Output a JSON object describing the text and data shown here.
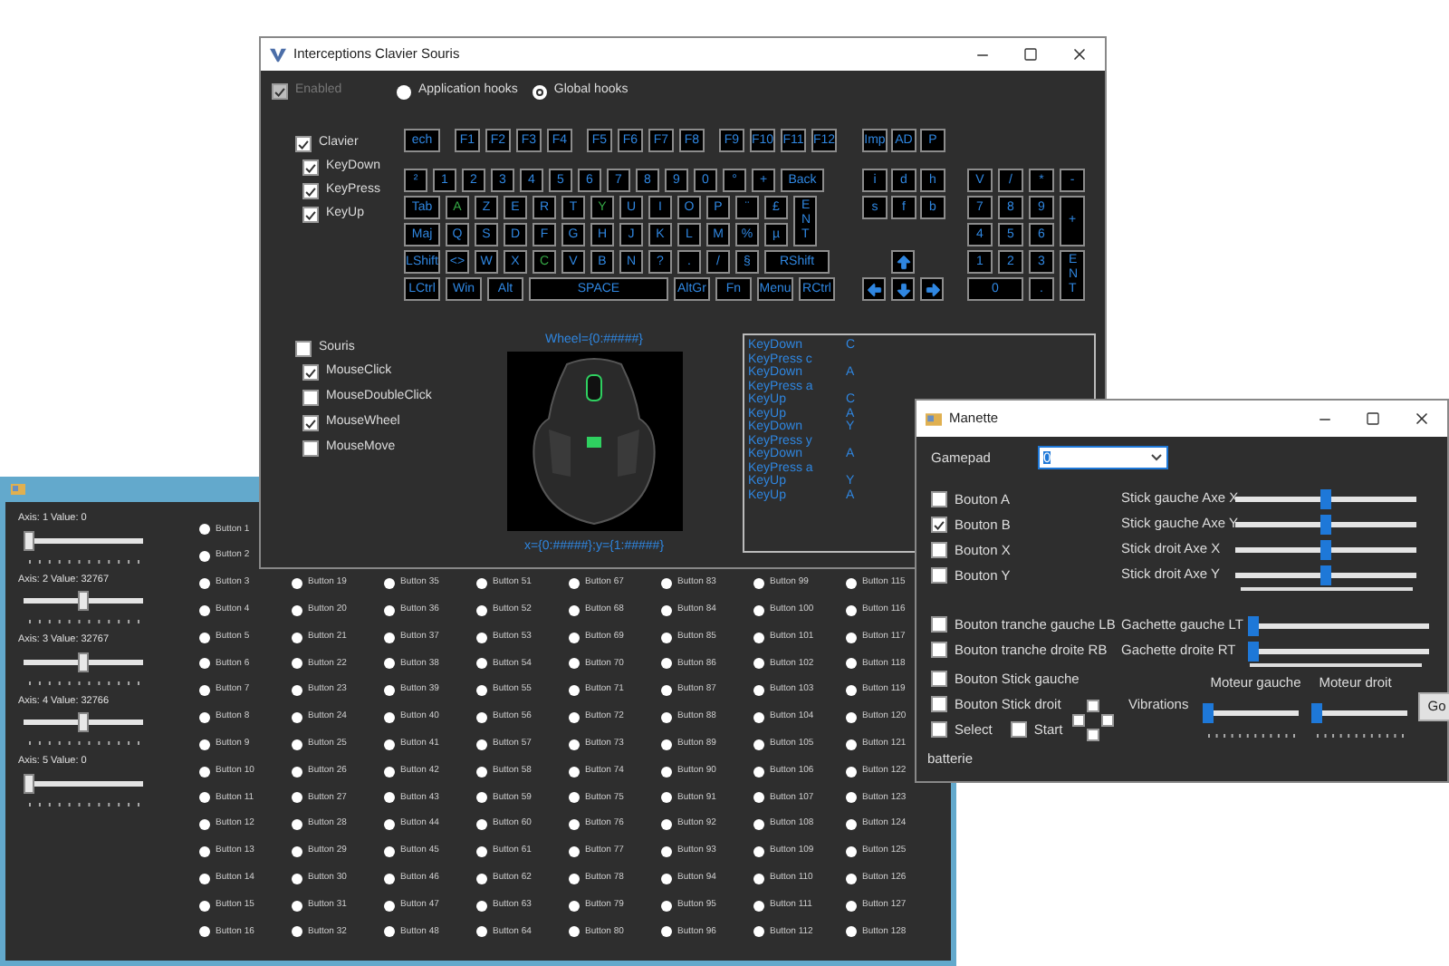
{
  "joystick_window": {
    "axes": [
      {
        "label": "Axis: 1  Value: 0",
        "level": 0
      },
      {
        "label": "Axis: 2  Value: 32767",
        "level": 0.5
      },
      {
        "label": "Axis: 3  Value: 32767",
        "level": 0.5
      },
      {
        "label": "Axis: 4  Value: 32766",
        "level": 0.5
      },
      {
        "label": "Axis: 5  Value: 0",
        "level": 0
      }
    ],
    "button_columns": [
      {
        "buttons": [
          {
            "label": "Button 1",
            "selected": false
          },
          {
            "label": "Button 2",
            "selected": false
          },
          {
            "label": "Button 3",
            "selected": false
          },
          {
            "label": "Button 4",
            "selected": false
          },
          {
            "label": "Button 5",
            "selected": false
          },
          {
            "label": "Button 6",
            "selected": false
          },
          {
            "label": "Button 7",
            "selected": false
          },
          {
            "label": "Button 8",
            "selected": false
          },
          {
            "label": "Button 9",
            "selected": false
          },
          {
            "label": "Button 10",
            "selected": false
          },
          {
            "label": "Button 11",
            "selected": false
          },
          {
            "label": "Button 12",
            "selected": false
          },
          {
            "label": "Button 13",
            "selected": false
          },
          {
            "label": "Button 14",
            "selected": false
          },
          {
            "label": "Button 15",
            "selected": false
          },
          {
            "label": "Button 16",
            "selected": false
          }
        ]
      },
      {
        "buttons": [
          {
            "label": "Button 19",
            "selected": false
          },
          {
            "label": "Button 20",
            "selected": false
          },
          {
            "label": "Button 21",
            "selected": false
          },
          {
            "label": "Button 22",
            "selected": false
          },
          {
            "label": "Button 23",
            "selected": false
          },
          {
            "label": "Button 24",
            "selected": false
          },
          {
            "label": "Button 25",
            "selected": false
          },
          {
            "label": "Button 26",
            "selected": false
          },
          {
            "label": "Button 27",
            "selected": false
          },
          {
            "label": "Button 28",
            "selected": false
          },
          {
            "label": "Button 29",
            "selected": false
          },
          {
            "label": "Button 30",
            "selected": false
          },
          {
            "label": "Button 31",
            "selected": false
          },
          {
            "label": "Button 32",
            "selected": false
          }
        ]
      },
      {
        "buttons": [
          {
            "label": "Button 35",
            "selected": false
          },
          {
            "label": "Button 36",
            "selected": false
          },
          {
            "label": "Button 37",
            "selected": false
          },
          {
            "label": "Button 38",
            "selected": false
          },
          {
            "label": "Button 39",
            "selected": false
          },
          {
            "label": "Button 40",
            "selected": false
          },
          {
            "label": "Button 41",
            "selected": false
          },
          {
            "label": "Button 42",
            "selected": false
          },
          {
            "label": "Button 43",
            "selected": false
          },
          {
            "label": "Button 44",
            "selected": false
          },
          {
            "label": "Button 45",
            "selected": false
          },
          {
            "label": "Button 46",
            "selected": false
          },
          {
            "label": "Button 47",
            "selected": false
          },
          {
            "label": "Button 48",
            "selected": false
          }
        ]
      },
      {
        "buttons": [
          {
            "label": "Button 51",
            "selected": false
          },
          {
            "label": "Button 52",
            "selected": false
          },
          {
            "label": "Button 53",
            "selected": false
          },
          {
            "label": "Button 54",
            "selected": false
          },
          {
            "label": "Button 55",
            "selected": false
          },
          {
            "label": "Button 56",
            "selected": false
          },
          {
            "label": "Button 57",
            "selected": false
          },
          {
            "label": "Button 58",
            "selected": false
          },
          {
            "label": "Button 59",
            "selected": false
          },
          {
            "label": "Button 60",
            "selected": false
          },
          {
            "label": "Button 61",
            "selected": false
          },
          {
            "label": "Button 62",
            "selected": false
          },
          {
            "label": "Button 63",
            "selected": false
          },
          {
            "label": "Button 64",
            "selected": false
          }
        ]
      },
      {
        "buttons": [
          {
            "label": "Button 67",
            "selected": false
          },
          {
            "label": "Button 68",
            "selected": false
          },
          {
            "label": "Button 69",
            "selected": false
          },
          {
            "label": "Button 70",
            "selected": false
          },
          {
            "label": "Button 71",
            "selected": false
          },
          {
            "label": "Button 72",
            "selected": false
          },
          {
            "label": "Button 73",
            "selected": false
          },
          {
            "label": "Button 74",
            "selected": false
          },
          {
            "label": "Button 75",
            "selected": false
          },
          {
            "label": "Button 76",
            "selected": false
          },
          {
            "label": "Button 77",
            "selected": false
          },
          {
            "label": "Button 78",
            "selected": false
          },
          {
            "label": "Button 79",
            "selected": false
          },
          {
            "label": "Button 80",
            "selected": false
          }
        ]
      },
      {
        "buttons": [
          {
            "label": "Button 83",
            "selected": false
          },
          {
            "label": "Button 84",
            "selected": false
          },
          {
            "label": "Button 85",
            "selected": false
          },
          {
            "label": "Button 86",
            "selected": false
          },
          {
            "label": "Button 87",
            "selected": false
          },
          {
            "label": "Button 88",
            "selected": false
          },
          {
            "label": "Button 89",
            "selected": false
          },
          {
            "label": "Button 90",
            "selected": false
          },
          {
            "label": "Button 91",
            "selected": false
          },
          {
            "label": "Button 92",
            "selected": false
          },
          {
            "label": "Button 93",
            "selected": false
          },
          {
            "label": "Button 94",
            "selected": false
          },
          {
            "label": "Button 95",
            "selected": false
          },
          {
            "label": "Button 96",
            "selected": false
          }
        ]
      },
      {
        "buttons": [
          {
            "label": "Button 99",
            "selected": false
          },
          {
            "label": "Button 100",
            "selected": false
          },
          {
            "label": "Button 101",
            "selected": false
          },
          {
            "label": "Button 102",
            "selected": false
          },
          {
            "label": "Button 103",
            "selected": false
          },
          {
            "label": "Button 104",
            "selected": false
          },
          {
            "label": "Button 105",
            "selected": false
          },
          {
            "label": "Button 106",
            "selected": false
          },
          {
            "label": "Button 107",
            "selected": false
          },
          {
            "label": "Button 108",
            "selected": false
          },
          {
            "label": "Button 109",
            "selected": false
          },
          {
            "label": "Button 110",
            "selected": false
          },
          {
            "label": "Button 111",
            "selected": false
          },
          {
            "label": "Button 112",
            "selected": false
          }
        ]
      },
      {
        "buttons": [
          {
            "label": "Button 115",
            "selected": false
          },
          {
            "label": "Button 116",
            "selected": false
          },
          {
            "label": "Button 117",
            "selected": false
          },
          {
            "label": "Button 118",
            "selected": false
          },
          {
            "label": "Button 119",
            "selected": false
          },
          {
            "label": "Button 120",
            "selected": false
          },
          {
            "label": "Button 121",
            "selected": false
          },
          {
            "label": "Button 122",
            "selected": false
          },
          {
            "label": "Button 123",
            "selected": false
          },
          {
            "label": "Button 124",
            "selected": false
          },
          {
            "label": "Button 125",
            "selected": false
          },
          {
            "label": "Button 126",
            "selected": false
          },
          {
            "label": "Button 127",
            "selected": false
          },
          {
            "label": "Button 128",
            "selected": false
          }
        ]
      }
    ]
  },
  "keyboard_window": {
    "title": "Interceptions Clavier Souris",
    "enabled": {
      "label": "Enabled",
      "checked": true,
      "disabled": true
    },
    "hooks": [
      {
        "label": "Application hooks",
        "selected": false
      },
      {
        "label": "Global hooks",
        "selected": true
      }
    ],
    "keyboard_group": {
      "label": "Clavier",
      "checked": true,
      "children": [
        {
          "label": "KeyDown",
          "checked": true
        },
        {
          "label": "KeyPress",
          "checked": true
        },
        {
          "label": "KeyUp",
          "checked": true
        }
      ]
    },
    "function_keys": [
      {
        "keys": [
          {
            "label": "ech",
            "kind": "wide",
            "pressed": false
          }
        ]
      },
      {
        "keys": [
          {
            "label": "F1",
            "kind": "normal",
            "pressed": false
          },
          {
            "label": "F2",
            "kind": "normal",
            "pressed": false
          },
          {
            "label": "F3",
            "kind": "normal",
            "pressed": false
          },
          {
            "label": "F4",
            "kind": "normal",
            "pressed": false
          }
        ]
      },
      {
        "keys": [
          {
            "label": "F5",
            "kind": "normal",
            "pressed": false
          },
          {
            "label": "F6",
            "kind": "normal",
            "pressed": false
          },
          {
            "label": "F7",
            "kind": "normal",
            "pressed": false
          },
          {
            "label": "F8",
            "kind": "normal",
            "pressed": false
          }
        ]
      },
      {
        "keys": [
          {
            "label": "F9",
            "kind": "normal",
            "pressed": false
          },
          {
            "label": "F10",
            "kind": "normal",
            "pressed": false
          },
          {
            "label": "F11",
            "kind": "normal",
            "pressed": false
          },
          {
            "label": "F12",
            "kind": "normal",
            "pressed": false
          }
        ]
      }
    ],
    "main_rows": [
      {
        "keys": [
          {
            "label": "²",
            "kind": "normal",
            "pressed": false
          },
          {
            "label": "1",
            "kind": "normal",
            "pressed": false
          },
          {
            "label": "2",
            "kind": "normal",
            "pressed": false
          },
          {
            "label": "3",
            "kind": "normal",
            "pressed": false
          },
          {
            "label": "4",
            "kind": "normal",
            "pressed": false
          },
          {
            "label": "5",
            "kind": "normal",
            "pressed": false
          },
          {
            "label": "6",
            "kind": "normal",
            "pressed": false
          },
          {
            "label": "7",
            "kind": "normal",
            "pressed": false
          },
          {
            "label": "8",
            "kind": "normal",
            "pressed": false
          },
          {
            "label": "9",
            "kind": "normal",
            "pressed": false
          },
          {
            "label": "0",
            "kind": "normal",
            "pressed": false
          },
          {
            "label": "°",
            "kind": "normal",
            "pressed": false
          },
          {
            "label": "+",
            "kind": "normal",
            "pressed": false
          },
          {
            "label": "Back",
            "kind": "back",
            "pressed": false
          }
        ]
      },
      {
        "keys": [
          {
            "label": "Tab",
            "kind": "wide",
            "pressed": false
          },
          {
            "label": "A",
            "kind": "normal",
            "pressed": true
          },
          {
            "label": "Z",
            "kind": "normal",
            "pressed": false
          },
          {
            "label": "E",
            "kind": "normal",
            "pressed": false
          },
          {
            "label": "R",
            "kind": "normal",
            "pressed": false
          },
          {
            "label": "T",
            "kind": "normal",
            "pressed": false
          },
          {
            "label": "Y",
            "kind": "normal",
            "pressed": true
          },
          {
            "label": "U",
            "kind": "normal",
            "pressed": false
          },
          {
            "label": "I",
            "kind": "normal",
            "pressed": false
          },
          {
            "label": "O",
            "kind": "normal",
            "pressed": false
          },
          {
            "label": "P",
            "kind": "normal",
            "pressed": false
          },
          {
            "label": "¨",
            "kind": "normal",
            "pressed": false
          },
          {
            "label": "£",
            "kind": "normal",
            "pressed": false
          }
        ]
      },
      {
        "keys": [
          {
            "label": "Maj",
            "kind": "wide",
            "pressed": false
          },
          {
            "label": "Q",
            "kind": "normal",
            "pressed": false
          },
          {
            "label": "S",
            "kind": "normal",
            "pressed": false
          },
          {
            "label": "D",
            "kind": "normal",
            "pressed": false
          },
          {
            "label": "F",
            "kind": "normal",
            "pressed": false
          },
          {
            "label": "G",
            "kind": "normal",
            "pressed": false
          },
          {
            "label": "H",
            "kind": "normal",
            "pressed": false
          },
          {
            "label": "J",
            "kind": "normal",
            "pressed": false
          },
          {
            "label": "K",
            "kind": "normal",
            "pressed": false
          },
          {
            "label": "L",
            "kind": "normal",
            "pressed": false
          },
          {
            "label": "M",
            "kind": "normal",
            "pressed": false
          },
          {
            "label": "%",
            "kind": "normal",
            "pressed": false
          },
          {
            "label": "µ",
            "kind": "normal",
            "pressed": false
          }
        ]
      },
      {
        "keys": [
          {
            "label": "LShift",
            "kind": "wide",
            "pressed": false
          },
          {
            "label": "<>",
            "kind": "normal",
            "pressed": false
          },
          {
            "label": "W",
            "kind": "normal",
            "pressed": false
          },
          {
            "label": "X",
            "kind": "normal",
            "pressed": false
          },
          {
            "label": "C",
            "kind": "normal",
            "pressed": true
          },
          {
            "label": "V",
            "kind": "normal",
            "pressed": false
          },
          {
            "label": "B",
            "kind": "normal",
            "pressed": false
          },
          {
            "label": "N",
            "kind": "normal",
            "pressed": false
          },
          {
            "label": "?",
            "kind": "normal",
            "pressed": false
          },
          {
            "label": ".",
            "kind": "normal",
            "pressed": false
          },
          {
            "label": "/",
            "kind": "normal",
            "pressed": false
          },
          {
            "label": "§",
            "kind": "normal",
            "pressed": false
          },
          {
            "label": "RShift",
            "kind": "xwide",
            "pressed": false
          }
        ]
      },
      {
        "keys": [
          {
            "label": "LCtrl",
            "kind": "wide",
            "pressed": false
          },
          {
            "label": "Win",
            "kind": "wide",
            "pressed": false
          },
          {
            "label": "Alt",
            "kind": "wide",
            "pressed": false
          },
          {
            "label": "SPACE",
            "kind": "space",
            "pressed": false
          },
          {
            "label": "AltGr",
            "kind": "wide",
            "pressed": false
          },
          {
            "label": "Fn",
            "kind": "wide",
            "pressed": false
          },
          {
            "label": "Menu",
            "kind": "wide",
            "pressed": false
          },
          {
            "label": "RCtrl",
            "kind": "wide",
            "pressed": false
          }
        ]
      }
    ],
    "enter_key": {
      "label": "ENT",
      "pressed": false
    },
    "system_keys": [
      {
        "label": "Imp",
        "pressed": false
      },
      {
        "label": "AD",
        "pressed": false
      },
      {
        "label": "P",
        "pressed": false
      }
    ],
    "nav_keys": [
      {
        "label": "i",
        "pressed": false
      },
      {
        "label": "d",
        "pressed": false
      },
      {
        "label": "h",
        "pressed": false
      },
      {
        "label": "s",
        "pressed": false
      },
      {
        "label": "f",
        "pressed": false
      },
      {
        "label": "b",
        "pressed": false
      }
    ],
    "arrow_keys": [
      {
        "kind": "up",
        "pressed": false
      },
      {
        "kind": "left",
        "pressed": false
      },
      {
        "kind": "down",
        "pressed": false
      },
      {
        "kind": "right",
        "pressed": false
      }
    ],
    "numpad": [
      {
        "label": "V",
        "kind": "normal",
        "pressed": false
      },
      {
        "label": "/",
        "kind": "normal",
        "pressed": false
      },
      {
        "label": "*",
        "kind": "normal",
        "pressed": false
      },
      {
        "label": "-",
        "kind": "normal",
        "pressed": false
      },
      {
        "label": "7",
        "kind": "normal",
        "pressed": false
      },
      {
        "label": "8",
        "kind": "normal",
        "pressed": false
      },
      {
        "label": "9",
        "kind": "normal",
        "pressed": false
      },
      {
        "label": "+",
        "kind": "tall",
        "pressed": false
      },
      {
        "label": "4",
        "kind": "normal",
        "pressed": false
      },
      {
        "label": "5",
        "kind": "normal",
        "pressed": false
      },
      {
        "label": "6",
        "kind": "normal",
        "pressed": false
      },
      {
        "label": "1",
        "kind": "normal",
        "pressed": false
      },
      {
        "label": "2",
        "kind": "normal",
        "pressed": false
      },
      {
        "label": "3",
        "kind": "normal",
        "pressed": false
      },
      {
        "label": "0",
        "kind": "wide",
        "pressed": false
      },
      {
        "label": ".",
        "kind": "normal",
        "pressed": false
      },
      {
        "label": "ENT",
        "kind": "enter",
        "pressed": false
      }
    ],
    "mouse_group": {
      "label": "Souris",
      "checked": false,
      "children": [
        {
          "label": "MouseClick",
          "checked": true
        },
        {
          "label": "MouseDoubleClick",
          "checked": false
        },
        {
          "label": "MouseWheel",
          "checked": true
        },
        {
          "label": "MouseMove",
          "checked": false
        }
      ]
    },
    "wheel_label": "Wheel={0:#####}",
    "position_label": "x={0:#####};y={1:#####}",
    "log": [
      {
        "event": "KeyDown",
        "key": "C",
        "kind": "column"
      },
      {
        "event": "KeyPress",
        "key": "c",
        "kind": "inline"
      },
      {
        "event": "KeyDown",
        "key": "A",
        "kind": "column"
      },
      {
        "event": "KeyPress",
        "key": "a",
        "kind": "inline"
      },
      {
        "event": "KeyUp",
        "key": "C",
        "kind": "column"
      },
      {
        "event": "KeyUp",
        "key": "A",
        "kind": "column"
      },
      {
        "event": "KeyDown",
        "key": "Y",
        "kind": "column"
      },
      {
        "event": "KeyPress",
        "key": "y",
        "kind": "inline"
      },
      {
        "event": "KeyDown",
        "key": "A",
        "kind": "column"
      },
      {
        "event": "KeyPress",
        "key": "a",
        "kind": "inline"
      },
      {
        "event": "KeyUp",
        "key": "Y",
        "kind": "column"
      },
      {
        "event": "KeyUp",
        "key": "A",
        "kind": "column"
      }
    ]
  },
  "manette_window": {
    "title": "Manette",
    "gamepad_label": "Gamepad",
    "gamepad_value": "0",
    "face_buttons": [
      {
        "label": "Bouton A",
        "checked": false
      },
      {
        "label": "Bouton B",
        "checked": true
      },
      {
        "label": "Bouton X",
        "checked": false
      },
      {
        "label": "Bouton Y",
        "checked": false
      }
    ],
    "stick_axes": [
      {
        "label": "Stick gauche Axe X",
        "level": 0.5
      },
      {
        "label": "Stick gauche Axe Y",
        "level": 0.5
      },
      {
        "label": "Stick droit Axe X",
        "level": 0.5
      },
      {
        "label": "Stick droit Axe Y",
        "level": 0.5
      }
    ],
    "shoulder_buttons": [
      {
        "label": "Bouton tranche gauche LB",
        "checked": false
      },
      {
        "label": "Bouton tranche droite RB",
        "checked": false
      }
    ],
    "triggers": [
      {
        "label": "Gachette gauche LT",
        "level": 0
      },
      {
        "label": "Gachette droite RT",
        "level": 0
      }
    ],
    "stick_buttons": [
      {
        "label": "Bouton Stick gauche",
        "checked": false
      },
      {
        "label": "Bouton Stick droit",
        "checked": false
      }
    ],
    "select": {
      "label": "Select",
      "checked": false
    },
    "start": {
      "label": "Start",
      "checked": false
    },
    "dpad": [
      {
        "checked": false
      },
      {
        "checked": false
      },
      {
        "checked": false
      },
      {
        "checked": false
      }
    ],
    "vibrations_label": "Vibrations",
    "motors": [
      {
        "label": "Moteur gauche",
        "level": 0
      },
      {
        "label": "Moteur droit",
        "level": 0
      }
    ],
    "go_button": "Go",
    "battery_label": "batterie"
  }
}
